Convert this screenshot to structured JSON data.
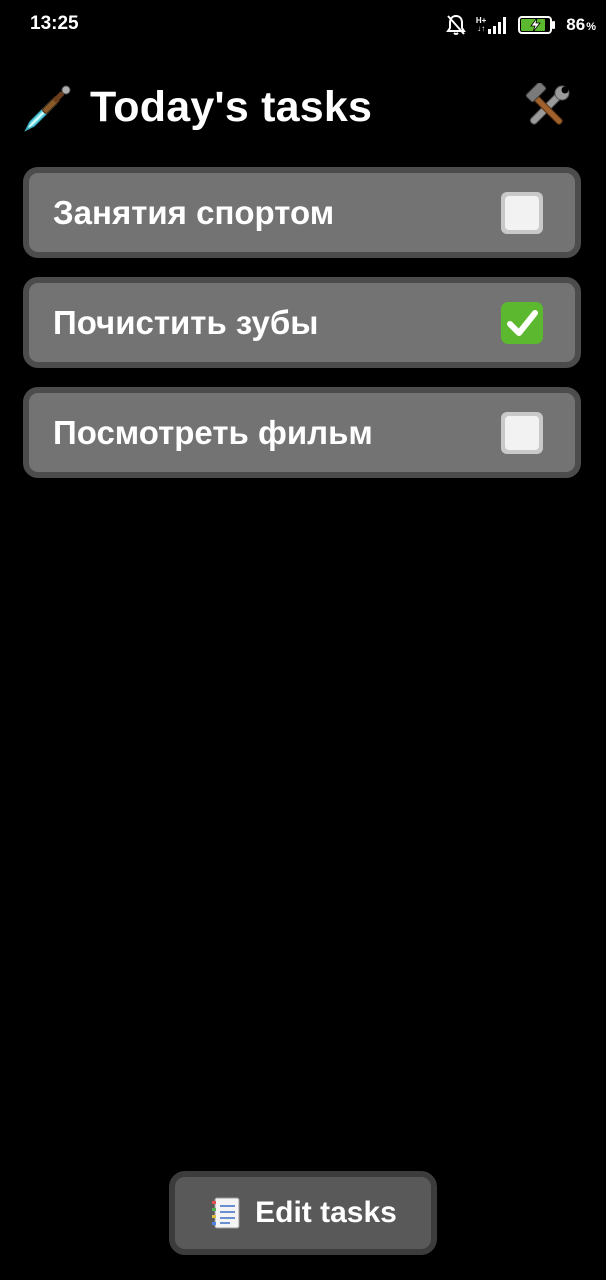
{
  "status_bar": {
    "time": "13:25",
    "network_type_top": "H+",
    "network_type_bottom": "↓↑",
    "battery_percent": "86",
    "battery_sign": "%",
    "icons": [
      "bell-muted-icon",
      "signal-icon",
      "battery-charging-icon"
    ]
  },
  "header": {
    "title": "Today's tasks",
    "title_icon": "sword-icon",
    "settings_icon": "hammer-and-wrench-icon"
  },
  "tasks": [
    {
      "label": "Занятия спортом",
      "done": false,
      "check_icon": "white-square-icon"
    },
    {
      "label": "Почистить зубы",
      "done": true,
      "check_icon": "green-check-icon"
    },
    {
      "label": "Посмотреть фильм",
      "done": false,
      "check_icon": "white-square-icon"
    }
  ],
  "footer": {
    "edit_label": "Edit tasks",
    "edit_icon": "notepad-icon"
  },
  "colors": {
    "background": "#000000",
    "card_fill": "#737373",
    "card_border": "#4c4c4c",
    "button_fill": "#595959",
    "button_border": "#3c3c3c",
    "check_green": "#5cb82e"
  }
}
